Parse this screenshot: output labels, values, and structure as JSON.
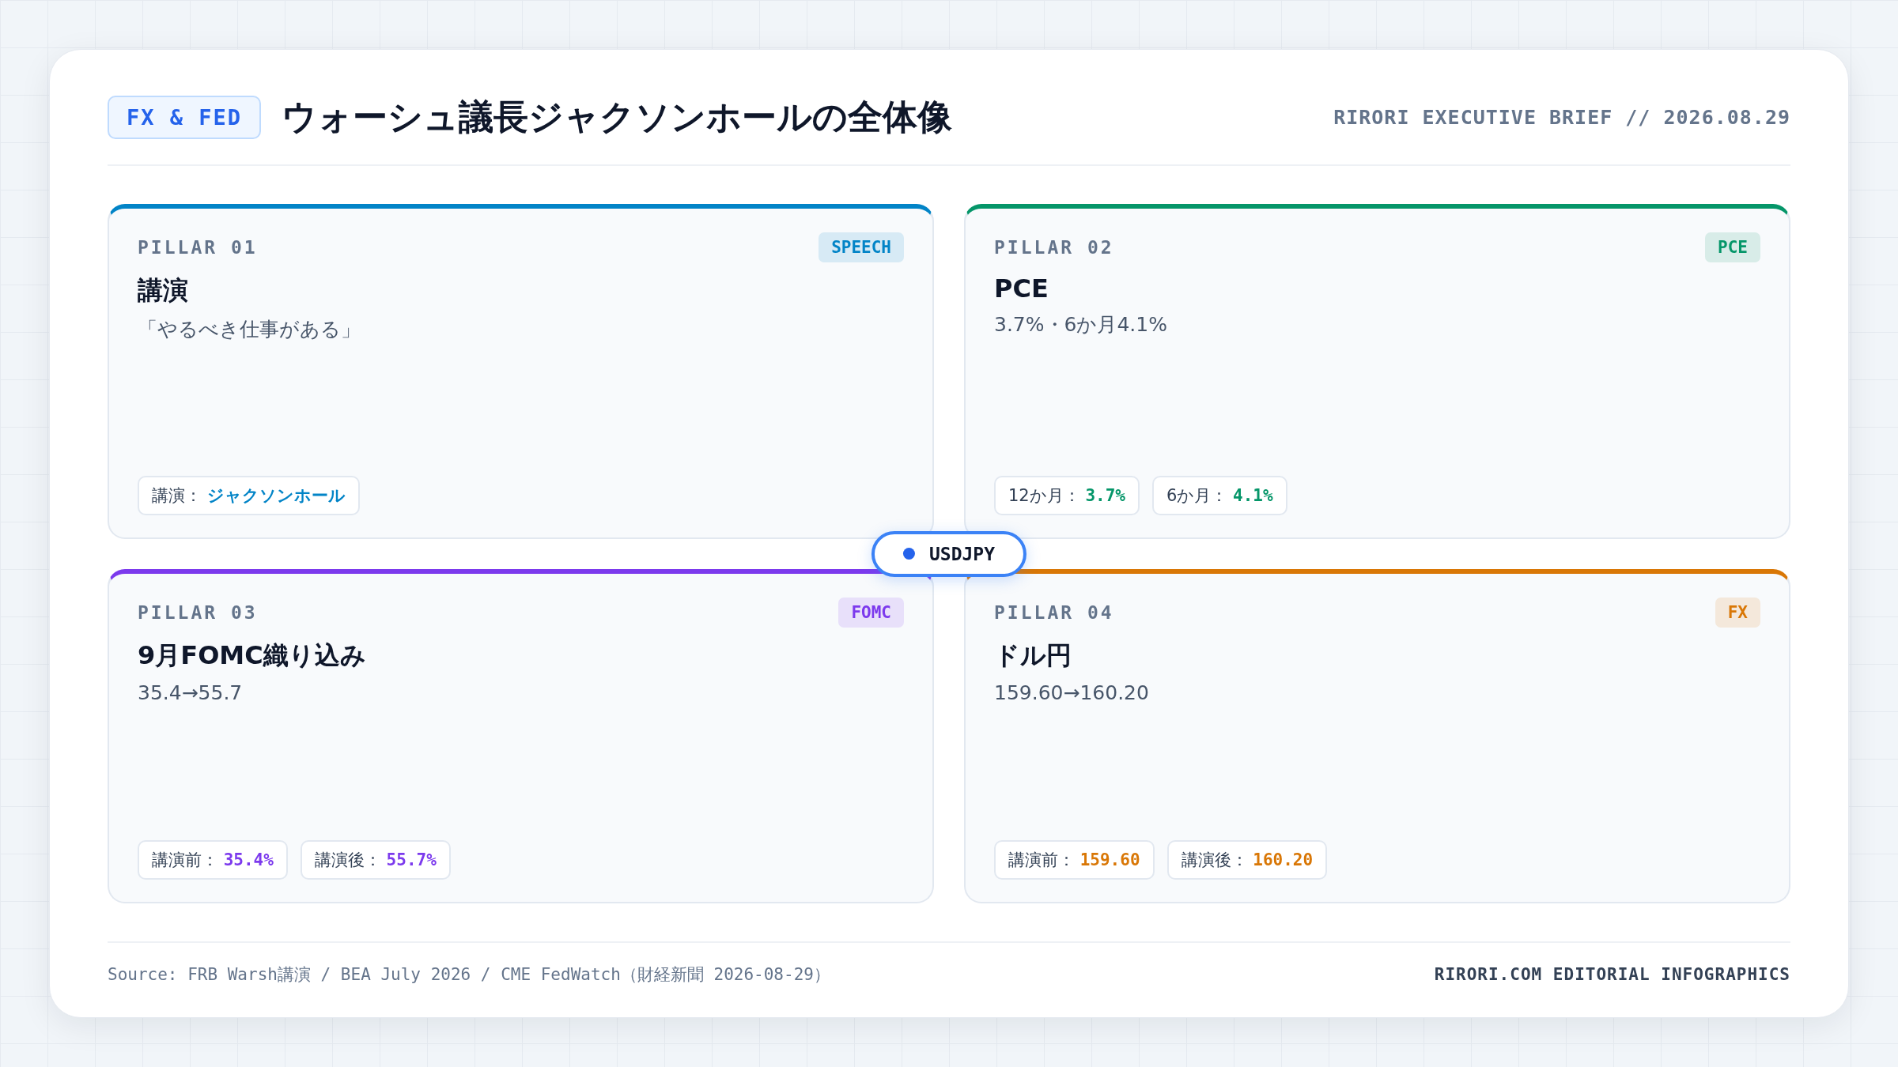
{
  "header": {
    "badge": "FX & FED",
    "title": "ウォーシュ議長ジャクソンホールの全体像",
    "brand": "RIRORI EXECUTIVE BRIEF // 2026.08.29"
  },
  "pillars": [
    {
      "label": "PILLAR 01",
      "tag": "SPEECH",
      "color": "#0284c7",
      "title": "講演",
      "subtitle": "「やるべき仕事がある」",
      "chips": [
        {
          "label": "講演：",
          "value": "ジャクソンホール"
        }
      ]
    },
    {
      "label": "PILLAR 02",
      "tag": "PCE",
      "color": "#059669",
      "title": "PCE",
      "subtitle": "3.7%・6か月4.1%",
      "chips": [
        {
          "label": "12か月：",
          "value": "3.7%"
        },
        {
          "label": "6か月：",
          "value": "4.1%"
        }
      ]
    },
    {
      "label": "PILLAR 03",
      "tag": "FOMC",
      "color": "#7c3aed",
      "title": "9月FOMC織り込み",
      "subtitle": "35.4→55.7",
      "chips": [
        {
          "label": "講演前：",
          "value": "35.4%"
        },
        {
          "label": "講演後：",
          "value": "55.7%"
        }
      ]
    },
    {
      "label": "PILLAR 04",
      "tag": "FX",
      "color": "#d97706",
      "title": "ドル円",
      "subtitle": "159.60→160.20",
      "chips": [
        {
          "label": "講演前：",
          "value": "159.60"
        },
        {
          "label": "講演後：",
          "value": "160.20"
        }
      ]
    }
  ],
  "center_badge": {
    "label": "USDJPY"
  },
  "footer": {
    "source": "Source: FRB Warsh講演 / BEA July 2026 / CME FedWatch（財経新聞 2026-08-29）",
    "credit": "RIRORI.COM EDITORIAL INFOGRAPHICS"
  }
}
